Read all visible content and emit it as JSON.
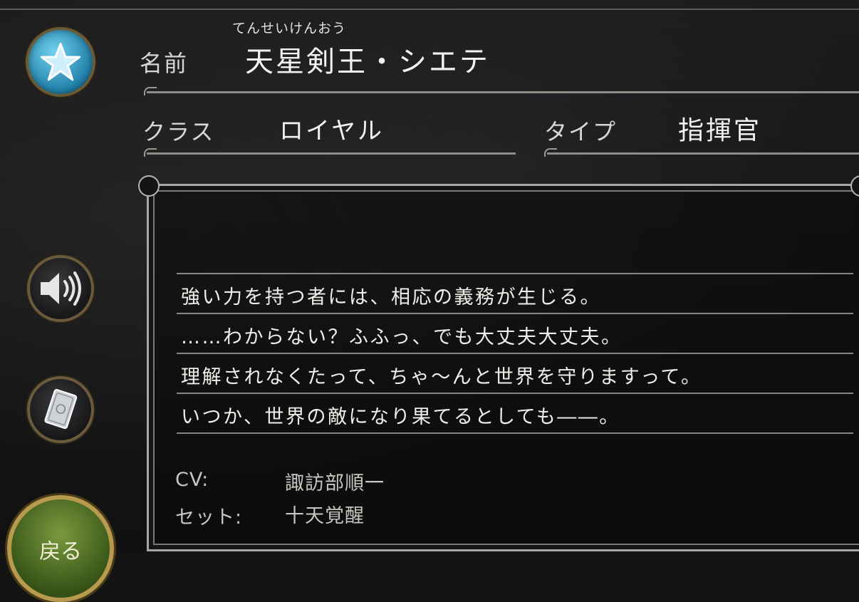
{
  "profile": {
    "name_label": "名前",
    "name_ruby": "てんせいけんおう",
    "name_value": "天星剣王・シエテ",
    "class_label": "クラス",
    "class_value": "ロイヤル",
    "type_label": "タイプ",
    "type_value": "指揮官"
  },
  "quote": {
    "lines": [
      "強い力を持つ者には、相応の義務が生じる。",
      "……わからない？ふふっ、でも大丈夫大丈夫。",
      "理解されなくたって、ちゃ〜んと世界を守りますって。",
      "いつか、世界の敵になり果てるとしても――。"
    ]
  },
  "meta": {
    "cv_label": "CV:",
    "cv_value": "諏訪部順一",
    "set_label": "セット:",
    "set_value": "十天覚醒"
  },
  "buttons": {
    "back_label": "戻る",
    "profile_icon": "star-icon",
    "voice_icon": "speaker-icon",
    "card_icon": "card-icon"
  },
  "colors": {
    "accent_blue": "#3aa6d0",
    "frame_gold": "#b89a4e",
    "back_green": "#5a7a2a",
    "text": "#f0eee8"
  }
}
